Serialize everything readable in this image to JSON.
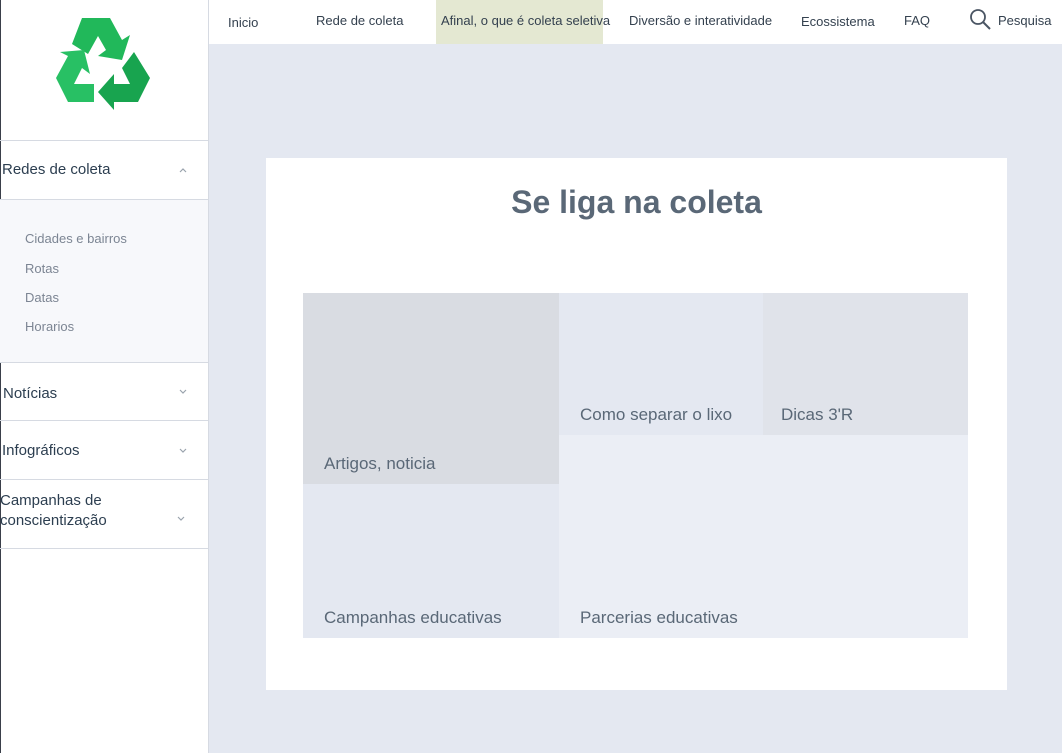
{
  "topnav": {
    "items": [
      {
        "label": "Inicio"
      },
      {
        "label": "Rede de coleta"
      },
      {
        "label": "Afinal, o que é coleta seletiva",
        "active": true
      },
      {
        "label": "Diversão e interatividade"
      },
      {
        "label": "Ecossistema"
      },
      {
        "label": "FAQ"
      }
    ],
    "search_label": "Pesquisa",
    "search_icon": "search-icon"
  },
  "sidebar": {
    "logo_icon": "recycle-icon",
    "sections": [
      {
        "label": "Redes de coleta",
        "expanded": true,
        "items": [
          "Cidades e bairros",
          "Rotas",
          "Datas",
          "Horarios"
        ]
      },
      {
        "label": "Notícias",
        "expanded": false
      },
      {
        "label": "Infográficos",
        "expanded": false
      },
      {
        "label": "Campanhas de conscientização",
        "expanded": false
      }
    ]
  },
  "main": {
    "title": "Se liga na coleta",
    "tiles": [
      {
        "label": "Artigos, noticia"
      },
      {
        "label": "Como separar o lixo"
      },
      {
        "label": "Dicas 3'R"
      },
      {
        "label": "Campanhas educativas"
      },
      {
        "label": "Parcerias educativas"
      }
    ]
  },
  "colors": {
    "background": "#e4e8f1",
    "active_nav": "#e4e8d2",
    "logo_green": "#1fb45a",
    "title_text": "#5a6877"
  }
}
